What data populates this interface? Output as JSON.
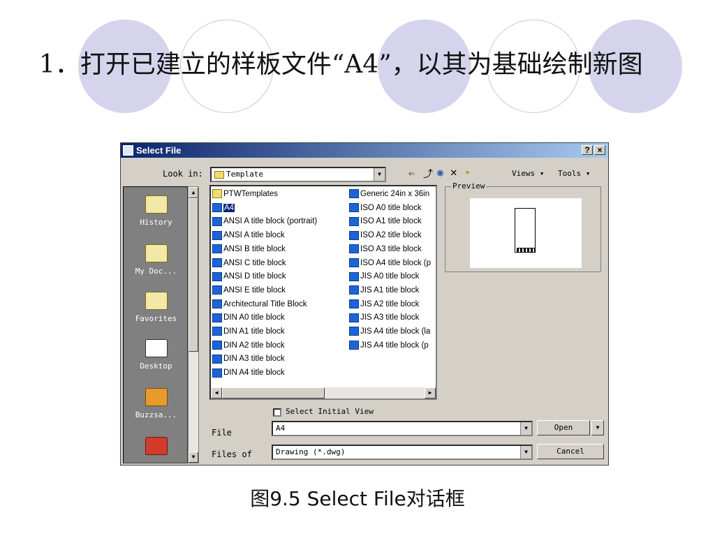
{
  "slide": {
    "title": "1．打开已建立的样板文件“A4”，以其为基础绘制新图",
    "caption": "图9.5  Select File对话框"
  },
  "dialog": {
    "title": "Select File",
    "help_label": "?",
    "close_label": "×",
    "look_in_label": "Look in:",
    "look_in_value": "Template",
    "views_label": "Views ▾",
    "tools_label": "Tools ▾",
    "preview_label": "Preview",
    "places": [
      "History",
      "My Doc...",
      "Favorites",
      "Desktop",
      "Buzzsa..."
    ],
    "files_col1": [
      "PTWTemplates",
      "A4",
      "ANSI A title block (portrait)",
      "ANSI A title block",
      "ANSI B title block",
      "ANSI C title block",
      "ANSI D title block",
      "ANSI E title block",
      "Architectural Title Block",
      "DIN A0 title block",
      "DIN A1 title block",
      "DIN A2 title block",
      "DIN A3 title block",
      "DIN A4 title block"
    ],
    "files_col2": [
      "Generic 24in x 36in",
      "ISO A0 title block",
      "ISO A1 title block",
      "ISO A2 title block",
      "ISO A3 title block",
      "ISO A4 title block (p",
      "JIS A0 title block",
      "JIS A1 title block",
      "JIS A2 title block",
      "JIS A3 title block",
      "JIS A4 title block (la",
      "JIS A4 title block (p"
    ],
    "selected_file": "A4",
    "select_initial_view_label": "Select Initial View",
    "file_name_label": "File",
    "file_name_value": "A4",
    "files_of_type_label": "Files of",
    "files_of_type_value": "Drawing (*.dwg)",
    "open_label": "Open",
    "cancel_label": "Cancel"
  },
  "colors": {
    "titlebar_start": "#0a246a",
    "titlebar_end": "#a6caf0",
    "circle_fill": "#d6d4ec",
    "dialog_face": "#d4d0c8"
  }
}
